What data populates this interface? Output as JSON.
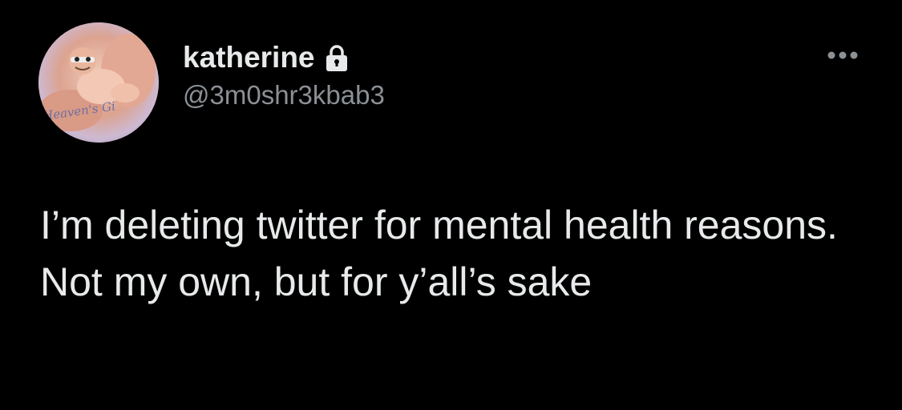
{
  "tweet": {
    "author": {
      "display_name": "katherine",
      "handle": "@3m0shr3kbab3",
      "protected_icon": "lock-icon",
      "avatar_caption": "Heaven's Gi"
    },
    "more_icon": "ellipsis-icon",
    "text": "I’m deleting twitter for mental health reasons. Not my own, but for y’all’s sake"
  },
  "colors": {
    "background": "#000000",
    "primary_text": "#e7e9ea",
    "secondary_text": "#8b9095"
  }
}
